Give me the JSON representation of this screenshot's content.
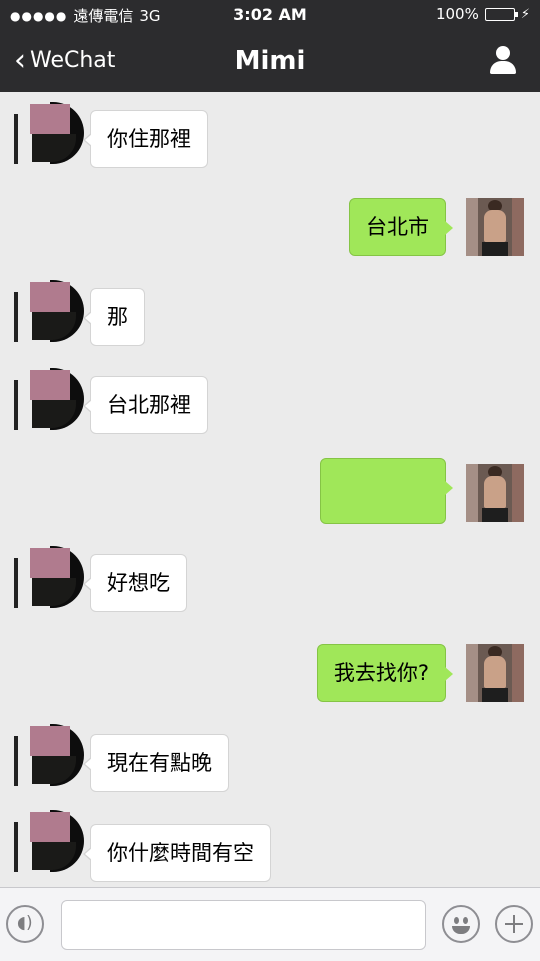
{
  "status_bar": {
    "signal": "●●●●●",
    "carrier": "遠傳電信",
    "network": "3G",
    "time": "3:02 AM",
    "battery": "100%"
  },
  "nav": {
    "back_label": "WeChat",
    "title": "Mimi"
  },
  "messages": [
    {
      "side": "left",
      "text": "你住那裡"
    },
    {
      "side": "right",
      "text": "台北市"
    },
    {
      "side": "left",
      "text": "那"
    },
    {
      "side": "left",
      "text": "台北那裡"
    },
    {
      "side": "right",
      "text": ""
    },
    {
      "side": "left",
      "text": "好想吃"
    },
    {
      "side": "right",
      "text": "我去找你?"
    },
    {
      "side": "left",
      "text": "現在有點晚"
    },
    {
      "side": "left",
      "text": "你什麼時間有空"
    }
  ],
  "icons": {
    "back": "chevron-left-icon",
    "profile": "person-icon",
    "voice": "voice-icon",
    "emoji": "emoji-icon",
    "more": "plus-icon"
  },
  "colors": {
    "header": "#2c2c2e",
    "sent_bubble": "#a0e759",
    "received_bubble": "#ffffff",
    "chat_bg": "#ebebeb"
  }
}
